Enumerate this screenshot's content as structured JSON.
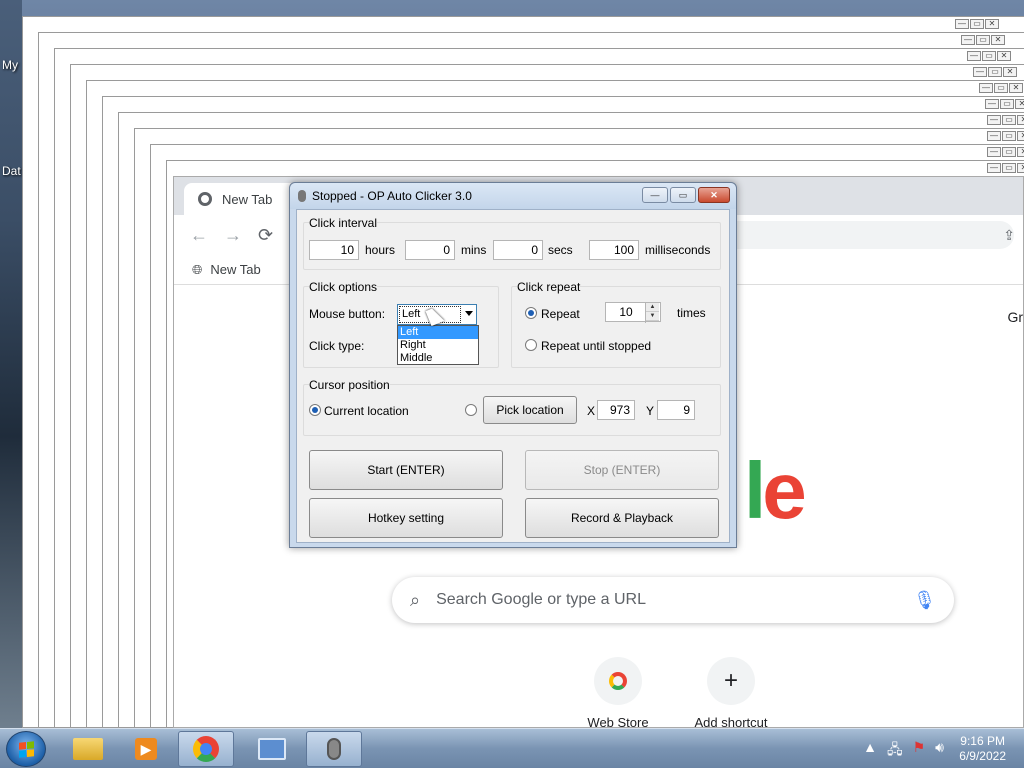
{
  "desktop": {
    "labels": [
      "My",
      "Dat"
    ]
  },
  "browser": {
    "tab_title": "New Tab",
    "bookmark_label": "New Tab",
    "partial_text": "Gr",
    "search_placeholder": "Search Google or type a URL",
    "logo_visible": "gle",
    "shortcuts": [
      {
        "label": "Web Store",
        "icon": "chrome-web-store-icon"
      },
      {
        "label": "Add shortcut",
        "icon": "plus-icon"
      }
    ]
  },
  "dialog": {
    "title": "Stopped - OP Auto Clicker 3.0",
    "click_interval": {
      "label": "Click interval",
      "hours": {
        "value": "10",
        "unit": "hours"
      },
      "mins": {
        "value": "0",
        "unit": "mins"
      },
      "secs": {
        "value": "0",
        "unit": "secs"
      },
      "ms": {
        "value": "100",
        "unit": "milliseconds"
      }
    },
    "click_options": {
      "label": "Click options",
      "mouse_button_label": "Mouse button:",
      "mouse_button_value": "Left",
      "click_type_label": "Click type:",
      "dropdown_options": [
        "Left",
        "Right",
        "Middle"
      ],
      "dropdown_selected": "Left"
    },
    "click_repeat": {
      "label": "Click repeat",
      "repeat_label": "Repeat",
      "repeat_value": "10",
      "times_label": "times",
      "until_stopped_label": "Repeat until stopped",
      "selected": "repeat"
    },
    "cursor_position": {
      "label": "Cursor position",
      "current_label": "Current location",
      "pick_label": "Pick location",
      "x_label": "X",
      "x_value": "973",
      "y_label": "Y",
      "y_value": "9",
      "selected": "current"
    },
    "buttons": {
      "start": "Start (ENTER)",
      "stop": "Stop (ENTER)",
      "hotkey": "Hotkey setting",
      "record": "Record & Playback"
    }
  },
  "taskbar": {
    "time": "9:16 PM",
    "date": "6/9/2022",
    "items": [
      "file-explorer-icon",
      "media-player-icon",
      "chrome-icon",
      "network-app-icon",
      "auto-clicker-mouse-icon"
    ]
  }
}
